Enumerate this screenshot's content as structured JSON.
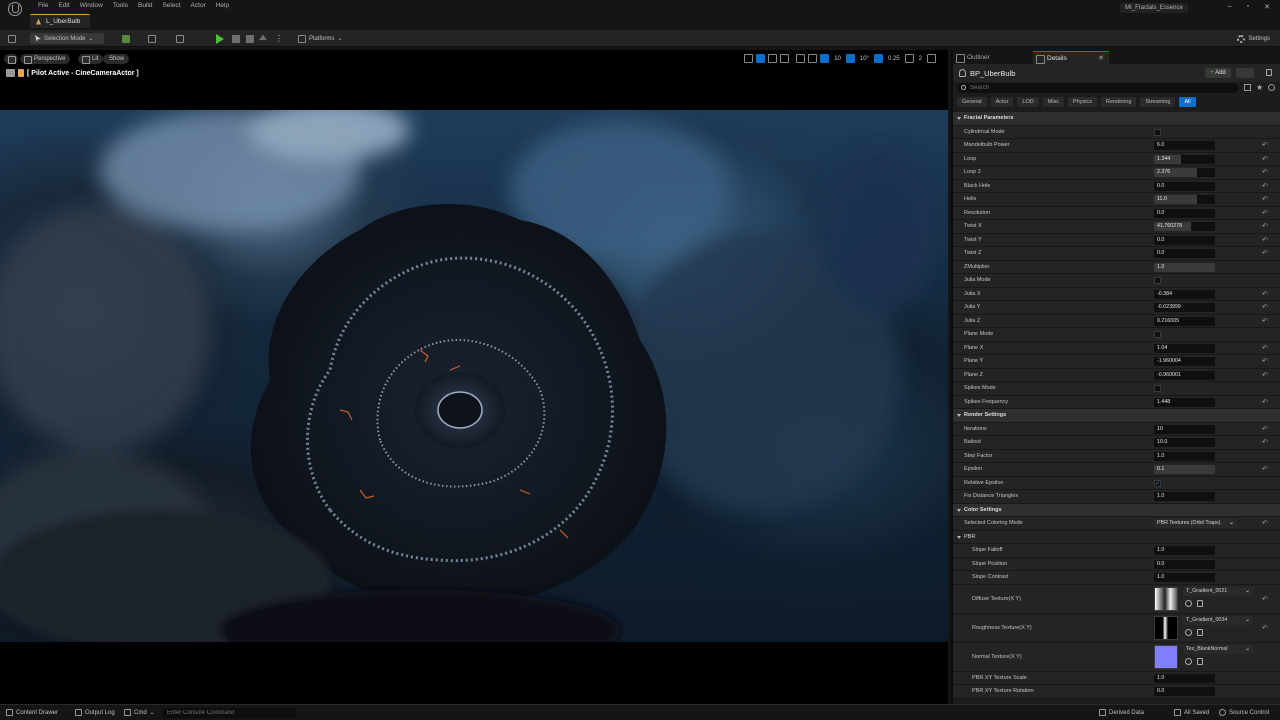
{
  "menubar": {
    "items": [
      "File",
      "Edit",
      "Window",
      "Tools",
      "Build",
      "Select",
      "Actor",
      "Help"
    ],
    "level_tab": "L_UberBulb",
    "project_name": "MI_Fractals_Essence",
    "window_controls": [
      "–",
      "▫",
      "✕"
    ]
  },
  "toolbar": {
    "mode_label": "Selection Mode",
    "platforms_label": "Platforms",
    "settings_label": "Settings"
  },
  "viewport": {
    "perspective_label": "Perspective",
    "lit_label": "Lit",
    "show_label": "Show",
    "pilot_label": "[ Pilot Active - CineCameraActor ]",
    "grid_snap": "10",
    "rotation_snap": "10°",
    "scale_snap": "0.25",
    "camera_speed": "2"
  },
  "panel": {
    "tab_outliner": "Outliner",
    "tab_details": "Details",
    "close_glyph": "✕",
    "object_name": "BP_UberBulb",
    "add_label": "Add",
    "search_placeholder": "Search",
    "filters": [
      "General",
      "Actor",
      "LOD",
      "Misc",
      "Physics",
      "Rendering",
      "Streaming",
      "All"
    ],
    "active_filter": "All",
    "reset_glyph": "↶",
    "check_glyph": "✓",
    "chevron_glyph": "⌄"
  },
  "properties": [
    {
      "kind": "cat",
      "label": "Fractal Parameters"
    },
    {
      "kind": "check",
      "label": "Cylindrical Mode",
      "checked": false
    },
    {
      "kind": "num",
      "label": "Mandelbulb Power",
      "value": "6.0",
      "fill": 0.0,
      "reset": true
    },
    {
      "kind": "num",
      "label": "Loop",
      "value": "1.344",
      "fill": 0.45,
      "reset": true
    },
    {
      "kind": "num",
      "label": "Loop 2",
      "value": "2.376",
      "fill": 0.7,
      "reset": true
    },
    {
      "kind": "num",
      "label": "Black Hole",
      "value": "0.0",
      "fill": 0.0,
      "reset": true
    },
    {
      "kind": "num",
      "label": "Helix",
      "value": "11.0",
      "fill": 0.7,
      "reset": true
    },
    {
      "kind": "num",
      "label": "Resolution",
      "value": "0.0",
      "fill": 0.0,
      "reset": true
    },
    {
      "kind": "num",
      "label": "Twist X",
      "value": "41.760278",
      "fill": 0.6,
      "reset": true
    },
    {
      "kind": "num",
      "label": "Twist Y",
      "value": "0.0",
      "fill": 0.0,
      "reset": true
    },
    {
      "kind": "num",
      "label": "Twist Z",
      "value": "0.0",
      "fill": 0.0,
      "reset": true
    },
    {
      "kind": "num",
      "label": "ZMultiplier",
      "value": "1.0",
      "fill": 1.0,
      "reset": false
    },
    {
      "kind": "check",
      "label": "Julia Mode",
      "checked": false
    },
    {
      "kind": "num",
      "label": "Julia X",
      "value": "-0.384",
      "fill": 0.0,
      "reset": true
    },
    {
      "kind": "num",
      "label": "Julia Y",
      "value": "-0.023999",
      "fill": 0.0,
      "reset": true
    },
    {
      "kind": "num",
      "label": "Julia Z",
      "value": "0.216005",
      "fill": 0.0,
      "reset": true
    },
    {
      "kind": "check",
      "label": "Plane Mode",
      "checked": false
    },
    {
      "kind": "num",
      "label": "Plane X",
      "value": "1.04",
      "fill": 0.0,
      "reset": true
    },
    {
      "kind": "num",
      "label": "Plane Y",
      "value": "-1.960004",
      "fill": 0.0,
      "reset": true
    },
    {
      "kind": "num",
      "label": "Plane Z",
      "value": "-0.960001",
      "fill": 0.0,
      "reset": true
    },
    {
      "kind": "check",
      "label": "Spikes Mode",
      "checked": false
    },
    {
      "kind": "num",
      "label": "Spikes Frequency",
      "value": "1.448",
      "fill": 0.0,
      "reset": true
    },
    {
      "kind": "cat",
      "label": "Render Settings"
    },
    {
      "kind": "num",
      "label": "Iterations",
      "value": "10",
      "fill": 0.0,
      "reset": true
    },
    {
      "kind": "num",
      "label": "Bailout",
      "value": "10.0",
      "fill": 0.0,
      "reset": true
    },
    {
      "kind": "num",
      "label": "Step Factor",
      "value": "1.0",
      "fill": 0.0,
      "reset": false
    },
    {
      "kind": "num",
      "label": "Epsilon",
      "value": "0.1",
      "fill": 1.0,
      "reset": true
    },
    {
      "kind": "check",
      "label": "Relative Epsilon",
      "checked": true
    },
    {
      "kind": "num",
      "label": "Fix Distance Triangles",
      "value": "1.0",
      "fill": 0.0,
      "reset": false
    },
    {
      "kind": "cat",
      "label": "Color Settings"
    },
    {
      "kind": "dropdown",
      "label": "Selected Coloring Mode",
      "value": "PBR Textures (Orbit Traps)",
      "reset": true
    },
    {
      "kind": "subcat",
      "label": "PBR"
    },
    {
      "kind": "subnum",
      "label": "Slope Falloff",
      "value": "1.0",
      "fill": 0.0,
      "reset": false
    },
    {
      "kind": "subnum",
      "label": "Slope Position",
      "value": "0.0",
      "fill": 0.0,
      "reset": false
    },
    {
      "kind": "subnum",
      "label": "Slope Contrast",
      "value": "1.0",
      "fill": 0.0,
      "reset": false
    },
    {
      "kind": "tex",
      "label": "Diffuse Texture(X Y)",
      "asset": "T_Gradient_0021",
      "thumb": "gradient-bw",
      "reset": true
    },
    {
      "kind": "tex",
      "label": "Roughness Texture(X Y)",
      "asset": "T_Gradient_0034",
      "thumb": "gradient-dark",
      "reset": true
    },
    {
      "kind": "tex",
      "label": "Normal Texture(X Y)",
      "asset": "Tex_BlankNormal",
      "thumb": "blank-normal",
      "reset": false
    },
    {
      "kind": "subnum",
      "label": "PBR XY Texture Scale",
      "value": "1.0",
      "fill": 0.0,
      "reset": false
    },
    {
      "kind": "subnum",
      "label": "PBR XY Texture Rotation",
      "value": "0.0",
      "fill": 0.0,
      "reset": false
    }
  ],
  "statusbar": {
    "content_drawer": "Content Drawer",
    "output_log": "Output Log",
    "cmd": "Cmd",
    "cmd_placeholder": "Enter Console Command",
    "derived_data": "Derived Data",
    "all_saved": "All Saved",
    "source_control": "Source Control"
  },
  "colors": {
    "accent_blue": "#0a6ed1",
    "play_green": "#4ec13a",
    "level_orange": "#e8a54a",
    "normal_texture": "#8080ff"
  }
}
